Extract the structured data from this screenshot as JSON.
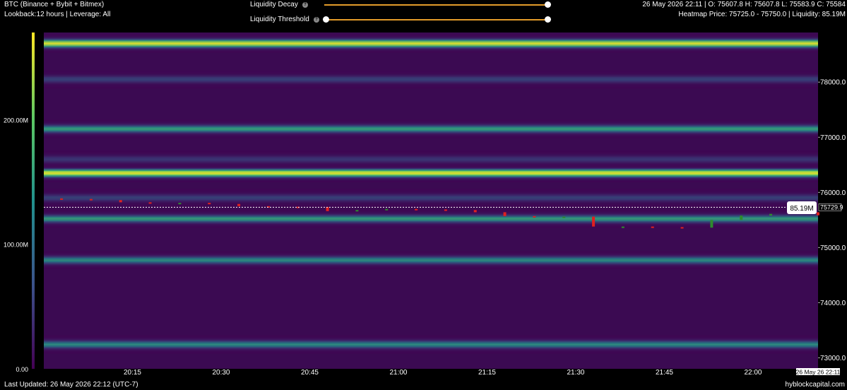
{
  "header": {
    "symbol_line": "BTC (Binance + Bybit + Bitmex)",
    "settings_line": "Lookback:12 hours | Leverage: All",
    "ohlc_line": "26 May 2026 22:11 | O: 75607.8 H: 75607.8 L: 75583.9 C: 75584",
    "heatmap_line": "Heatmap Price: 75725.0 - 75750.0 | Liquidity: 85.19M"
  },
  "controls": {
    "liquidity_decay_label": "Liquidity Decay",
    "liquidity_threshold_label": "Liquidity Threshold",
    "liquidity_decay_value": 1.0,
    "liquidity_threshold_range": [
      0.0,
      1.0
    ],
    "slider_color": "#e39b2a"
  },
  "footer": {
    "last_updated": "Last Updated: 26 May 2026 22:12 (UTC-7)",
    "brand": "hyblockcapital.com"
  },
  "chart_data": {
    "type": "heatmap",
    "title": "",
    "x_ticks": [
      "20:15",
      "20:30",
      "20:45",
      "21:00",
      "21:15",
      "21:30",
      "21:45",
      "22:00"
    ],
    "x_end_label": "26 May 26 22:11",
    "y_ticks": [
      "78000.0",
      "77000.0",
      "76000.0",
      "75000.0",
      "74000.0",
      "73000.0"
    ],
    "ylim": [
      72800,
      78900
    ],
    "current_price_label": "75729.9",
    "current_liquidity_label": "85.19M",
    "colorbar_ticks": [
      "200.00M",
      "100.00M",
      "0.00"
    ],
    "colorbar_range": [
      0,
      270
    ],
    "colormap": [
      "#440154",
      "#3b528b",
      "#21918c",
      "#5ec962",
      "#fde725"
    ],
    "liquidity_bands": [
      {
        "price": 78700,
        "level": 0.95
      },
      {
        "price": 77150,
        "level": 0.6
      },
      {
        "price": 76350,
        "level": 0.95
      },
      {
        "price": 75520,
        "level": 0.6
      },
      {
        "price": 74770,
        "level": 0.55
      },
      {
        "price": 73240,
        "level": 0.55
      },
      {
        "price": 75900,
        "level": 0.3
      },
      {
        "price": 76600,
        "level": 0.25
      },
      {
        "price": 78050,
        "level": 0.3
      }
    ],
    "candles": {
      "x": [
        "20:03",
        "20:08",
        "20:13",
        "20:18",
        "20:23",
        "20:28",
        "20:33",
        "20:38",
        "20:43",
        "20:48",
        "20:53",
        "20:58",
        "21:03",
        "21:08",
        "21:13",
        "21:18",
        "21:23",
        "21:28",
        "21:33",
        "21:38",
        "21:43",
        "21:48",
        "21:53",
        "21:58",
        "22:03",
        "22:08",
        "22:11"
      ],
      "close": [
        75880,
        75860,
        75820,
        75800,
        75810,
        75790,
        75750,
        75740,
        75735,
        75660,
        75680,
        75700,
        75690,
        75680,
        75640,
        75570,
        75545,
        75560,
        75380,
        75380,
        75370,
        75360,
        75500,
        75580,
        75610,
        75640,
        75584
      ],
      "up_color": "#2e8b2e",
      "down_color": "#e02020"
    }
  }
}
